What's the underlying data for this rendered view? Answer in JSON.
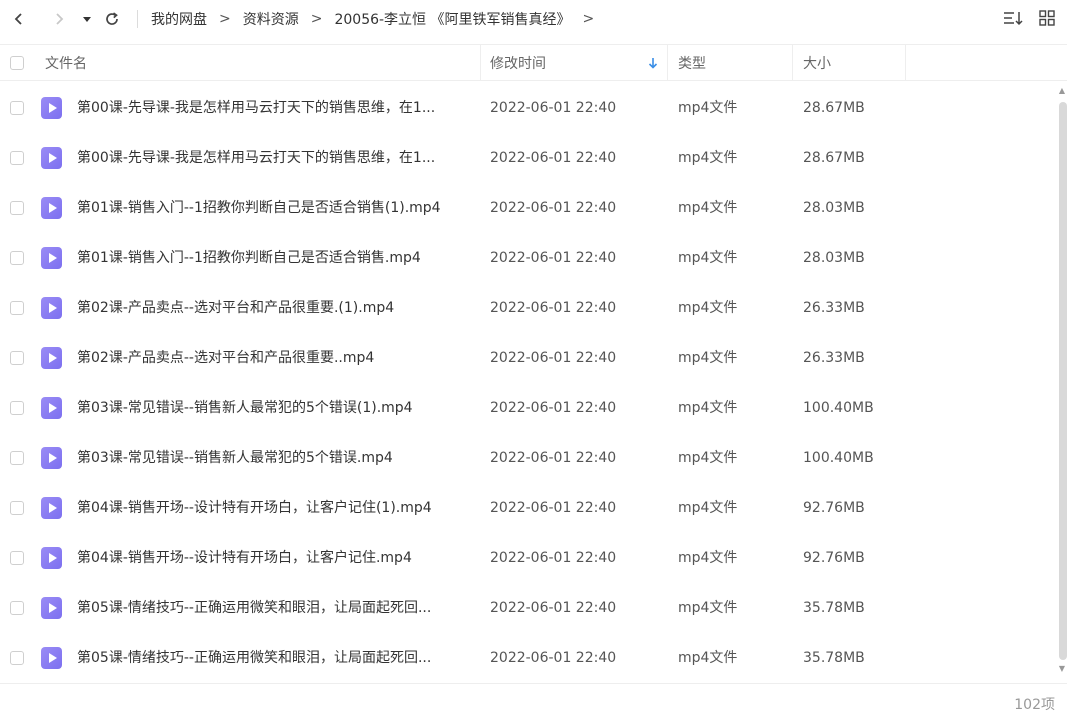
{
  "nav": {
    "breadcrumbs": [
      "我的网盘",
      "资料资源",
      "20056-李立恒 《阿里铁军销售真经》"
    ],
    "sep": ">",
    "trail_sep": ">"
  },
  "header": {
    "name": "文件名",
    "mtime": "修改时间",
    "type": "类型",
    "size": "大小"
  },
  "files": [
    {
      "name": "第00课-先导课-我是怎样用马云打天下的销售思维，在1...",
      "time": "2022-06-01 22:40",
      "type": "mp4文件",
      "size": "28.67MB"
    },
    {
      "name": "第00课-先导课-我是怎样用马云打天下的销售思维，在1...",
      "time": "2022-06-01 22:40",
      "type": "mp4文件",
      "size": "28.67MB"
    },
    {
      "name": "第01课-销售入门--1招教你判断自己是否适合销售(1).mp4",
      "time": "2022-06-01 22:40",
      "type": "mp4文件",
      "size": "28.03MB"
    },
    {
      "name": "第01课-销售入门--1招教你判断自己是否适合销售.mp4",
      "time": "2022-06-01 22:40",
      "type": "mp4文件",
      "size": "28.03MB"
    },
    {
      "name": "第02课-产品卖点--选对平台和产品很重要.(1).mp4",
      "time": "2022-06-01 22:40",
      "type": "mp4文件",
      "size": "26.33MB"
    },
    {
      "name": "第02课-产品卖点--选对平台和产品很重要..mp4",
      "time": "2022-06-01 22:40",
      "type": "mp4文件",
      "size": "26.33MB"
    },
    {
      "name": "第03课-常见错误--销售新人最常犯的5个错误(1).mp4",
      "time": "2022-06-01 22:40",
      "type": "mp4文件",
      "size": "100.40MB"
    },
    {
      "name": "第03课-常见错误--销售新人最常犯的5个错误.mp4",
      "time": "2022-06-01 22:40",
      "type": "mp4文件",
      "size": "100.40MB"
    },
    {
      "name": "第04课-销售开场--设计特有开场白，让客户记住(1).mp4",
      "time": "2022-06-01 22:40",
      "type": "mp4文件",
      "size": "92.76MB"
    },
    {
      "name": "第04课-销售开场--设计特有开场白，让客户记住.mp4",
      "time": "2022-06-01 22:40",
      "type": "mp4文件",
      "size": "92.76MB"
    },
    {
      "name": "第05课-情绪技巧--正确运用微笑和眼泪，让局面起死回...",
      "time": "2022-06-01 22:40",
      "type": "mp4文件",
      "size": "35.78MB"
    },
    {
      "name": "第05课-情绪技巧--正确运用微笑和眼泪，让局面起死回...",
      "time": "2022-06-01 22:40",
      "type": "mp4文件",
      "size": "35.78MB"
    }
  ],
  "footer": {
    "count": "102项"
  },
  "colors": {
    "accent": "#3a8ee6",
    "file_icon": "#8a7cf4"
  }
}
